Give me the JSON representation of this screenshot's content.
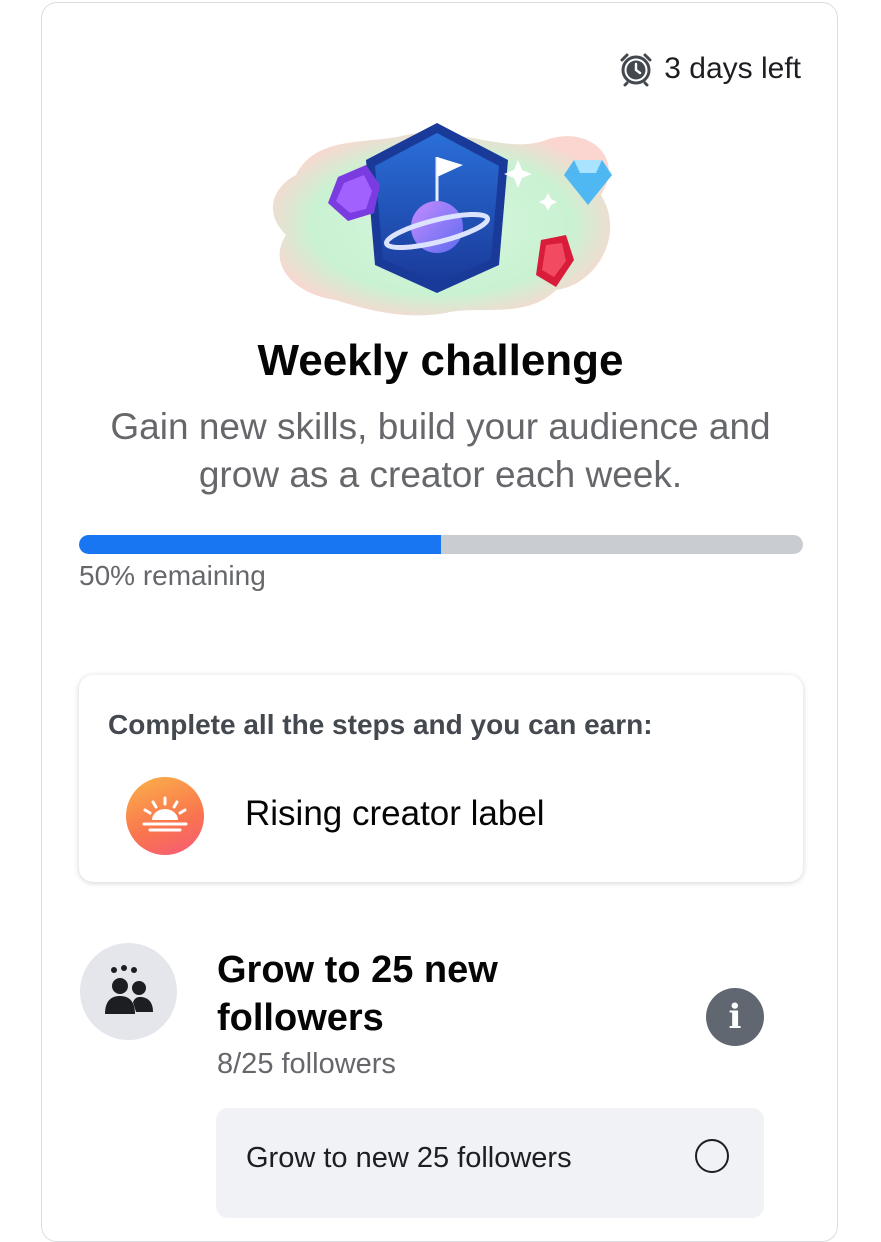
{
  "challenge": {
    "time_left": "3 days left",
    "title": "Weekly challenge",
    "subtitle": "Gain new skills, build your audience and grow as a creator each week.",
    "progress_fraction": 0.5,
    "progress_label": "50% remaining",
    "illustration_icon": "planet-badge-illustration"
  },
  "reward": {
    "intro": "Complete all the steps and you can earn:",
    "label": "Rising creator label",
    "icon": "sunrise-icon"
  },
  "task": {
    "icon": "followers-icon",
    "title": "Grow to 25 new followers",
    "progress": "8/25 followers",
    "info_icon": "info-icon",
    "steps": [
      {
        "label": "Grow to new 25 followers",
        "completed": false
      }
    ]
  },
  "colors": {
    "accent": "#1876f2",
    "track": "#c9ccd1",
    "secondary_text": "#65676b"
  }
}
